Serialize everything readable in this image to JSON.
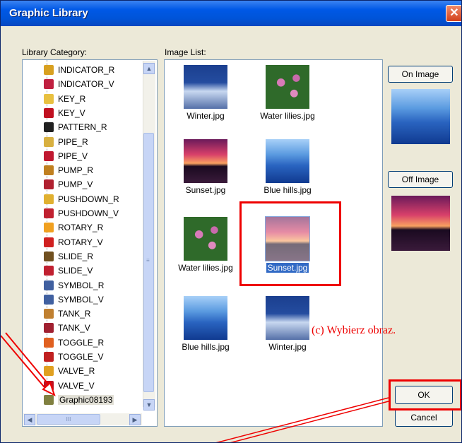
{
  "window": {
    "title": "Graphic Library",
    "close_glyph": "✕"
  },
  "labels": {
    "library_category": "Library Category:",
    "image_list": "Image List:"
  },
  "tree": {
    "items": [
      {
        "label": "INDICATOR_R",
        "color": "#d8a020"
      },
      {
        "label": "INDICATOR_V",
        "color": "#c02040"
      },
      {
        "label": "KEY_R",
        "color": "#e8c040"
      },
      {
        "label": "KEY_V",
        "color": "#c01020"
      },
      {
        "label": "PATTERN_R",
        "color": "#202020"
      },
      {
        "label": "PIPE_R",
        "color": "#d8b040"
      },
      {
        "label": "PIPE_V",
        "color": "#c01830"
      },
      {
        "label": "PUMP_R",
        "color": "#c08020"
      },
      {
        "label": "PUMP_V",
        "color": "#b02030"
      },
      {
        "label": "PUSHDOWN_R",
        "color": "#e0b030"
      },
      {
        "label": "PUSHDOWN_V",
        "color": "#c02030"
      },
      {
        "label": "ROTARY_R",
        "color": "#f0a020"
      },
      {
        "label": "ROTARY_V",
        "color": "#d02020"
      },
      {
        "label": "SLIDE_R",
        "color": "#705020"
      },
      {
        "label": "SLIDE_V",
        "color": "#c02030"
      },
      {
        "label": "SYMBOL_R",
        "color": "#4060a0"
      },
      {
        "label": "SYMBOL_V",
        "color": "#4060a0"
      },
      {
        "label": "TANK_R",
        "color": "#c08030"
      },
      {
        "label": "TANK_V",
        "color": "#a02030"
      },
      {
        "label": "TOGGLE_R",
        "color": "#e06020"
      },
      {
        "label": "TOGGLE_V",
        "color": "#c02020"
      },
      {
        "label": "VALVE_R",
        "color": "#e0a020"
      },
      {
        "label": "VALVE_V",
        "color": "#c01020"
      },
      {
        "label": "Graphic08193",
        "color": "#808040"
      }
    ],
    "scroll_grip": "≡",
    "hscroll_grip": "III"
  },
  "images": [
    {
      "caption": "Winter.jpg",
      "kind": "winter"
    },
    {
      "caption": "Water lilies.jpg",
      "kind": "water"
    },
    {
      "caption": "Sunset.jpg",
      "kind": "sunset"
    },
    {
      "caption": "Blue hills.jpg",
      "kind": "blue"
    },
    {
      "caption": "Water lilies.jpg",
      "kind": "water"
    },
    {
      "caption": "Sunset.jpg",
      "kind": "sunset"
    },
    {
      "caption": "Blue hills.jpg",
      "kind": "blue"
    },
    {
      "caption": "Winter.jpg",
      "kind": "winter"
    }
  ],
  "buttons": {
    "on_image": "On Image",
    "off_image": "Off Image",
    "ok": "OK",
    "cancel": "Cancel"
  },
  "annotation": {
    "text": "(c) Wybierz obraz.",
    "color": "#e00000"
  }
}
